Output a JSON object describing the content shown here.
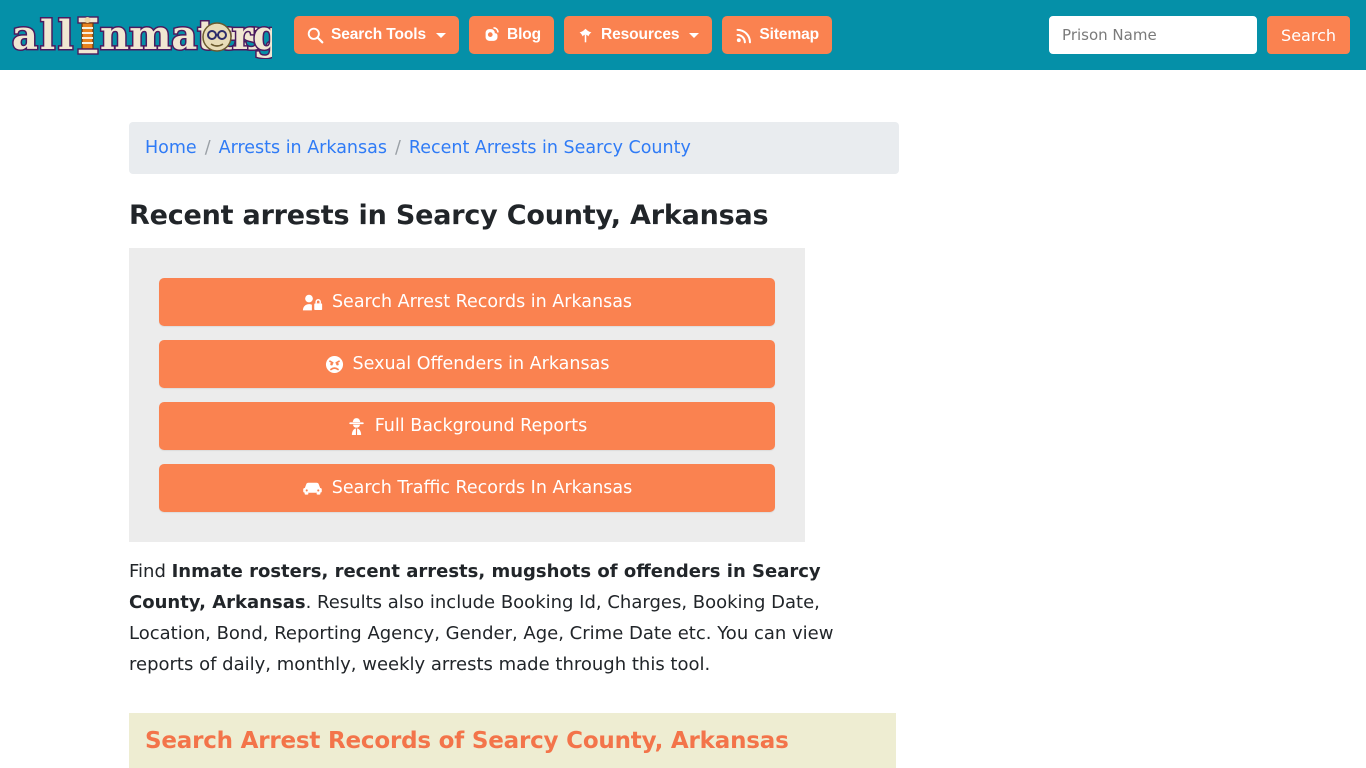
{
  "header": {
    "logo": {
      "text": "allInmates.org",
      "alt": "allinmates.org logo"
    },
    "nav": [
      {
        "label": "Search Tools",
        "icon": "magnifier-icon",
        "has_caret": true
      },
      {
        "label": "Blog",
        "icon": "blogger-b-icon",
        "has_caret": false
      },
      {
        "label": "Resources",
        "icon": "leaf-icon",
        "has_caret": true
      },
      {
        "label": "Sitemap",
        "icon": "rss-feed-icon",
        "has_caret": false
      }
    ],
    "search": {
      "placeholder": "Prison Name",
      "value": "",
      "button_label": "Search"
    }
  },
  "breadcrumb": {
    "items": [
      {
        "label": "Home",
        "link": true
      },
      {
        "label": "Arrests in Arkansas",
        "link": true
      },
      {
        "label": "Recent Arrests in Searcy County",
        "link": true
      }
    ],
    "separator": "/"
  },
  "main": {
    "page_title": "Recent arrests in Searcy County, Arkansas",
    "action_buttons": [
      {
        "label": "Search Arrest Records in Arkansas",
        "icon": "user-lock-icon"
      },
      {
        "label": "Sexual Offenders in Arkansas",
        "icon": "angry-face-icon"
      },
      {
        "label": "Full Background Reports",
        "icon": "user-secret-icon"
      },
      {
        "label": "Search Traffic Records In Arkansas",
        "icon": "car-icon"
      }
    ],
    "paragraph": {
      "lead": "Find ",
      "bold": "Inmate rosters, recent arrests, mugshots of offenders in Searcy County, Arkansas",
      "rest": ". Results also include Booking Id, Charges, Booking Date, Location, Bond, Reporting Agency, Gender, Age, Crime Date etc. You can view reports of daily, monthly, weekly arrests made through this tool."
    },
    "section_heading": "Search Arrest Records of Searcy County, Arkansas"
  },
  "colors": {
    "header_teal": "#0590a8",
    "accent_orange": "#fa8250",
    "breadcrumb_bg": "#e9ecef",
    "panel_gray": "#ececec",
    "band_bg": "#eeedd2",
    "band_text": "#f3744a",
    "link_blue": "#2f7bf6"
  }
}
